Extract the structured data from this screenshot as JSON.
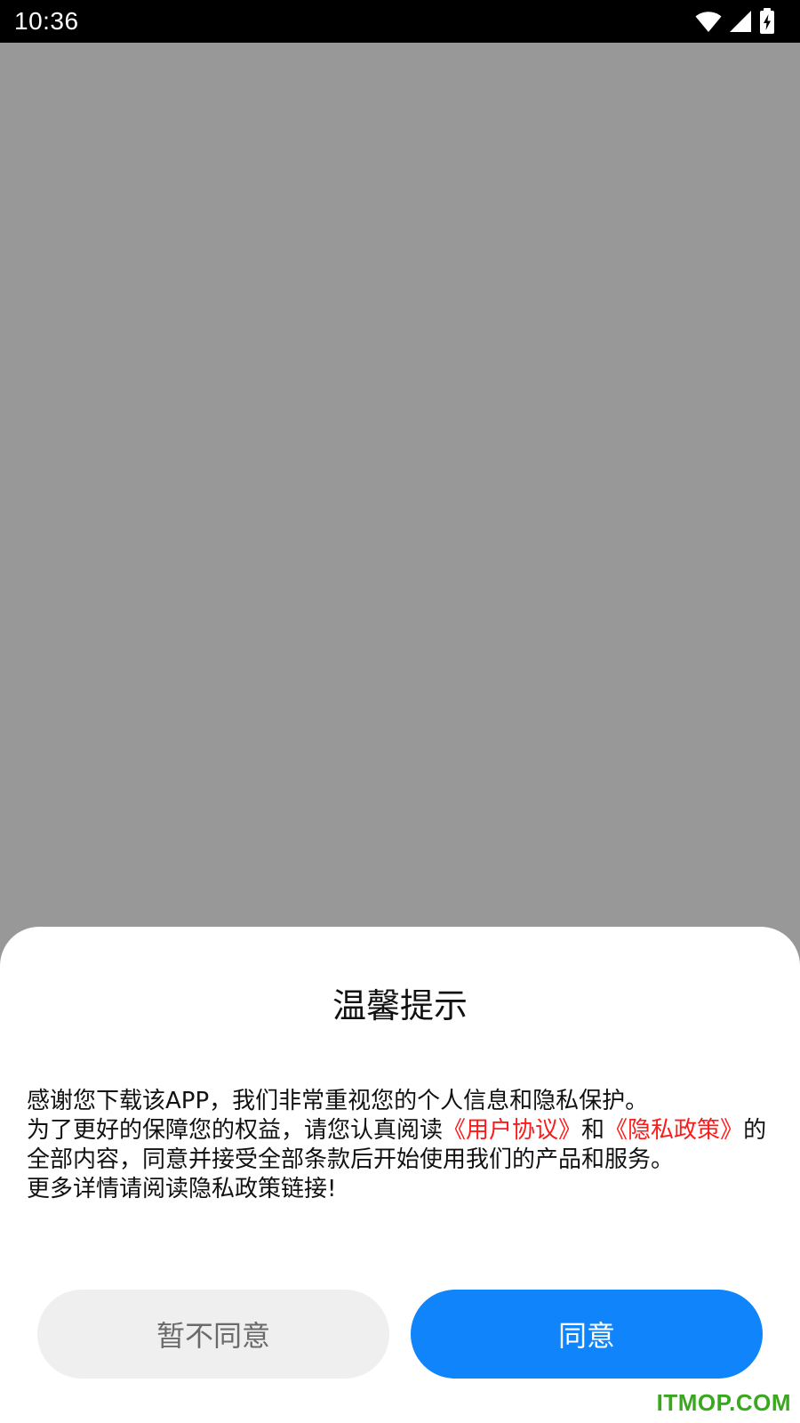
{
  "status_bar": {
    "time": "10:36",
    "icons": [
      "wifi-icon",
      "cellular-signal-icon",
      "battery-charging-icon"
    ]
  },
  "dialog": {
    "title": "温馨提示",
    "paragraph1": "感谢您下载该APP，我们非常重视您的个人信息和隐私保护。",
    "paragraph2_prefix": " 为了更好的保障您的权益，请您认真阅读",
    "link_user_agreement": "《用户协议》",
    "conjunction": "和",
    "link_privacy_policy": "《隐私政策》",
    "paragraph2_suffix": "的全部内容，同意并接受全部条款后开始使用我们的产品和服务。",
    "paragraph3": " 更多详情请阅读隐私政策链接!",
    "decline_label": "暂不同意",
    "agree_label": "同意"
  },
  "watermark": "ITMOP.COM",
  "colors": {
    "overlay": "#989898",
    "link": "#ff1a1a",
    "primary_button": "#0f84fb",
    "secondary_button": "#efefef",
    "watermark": "#3aa81e"
  }
}
